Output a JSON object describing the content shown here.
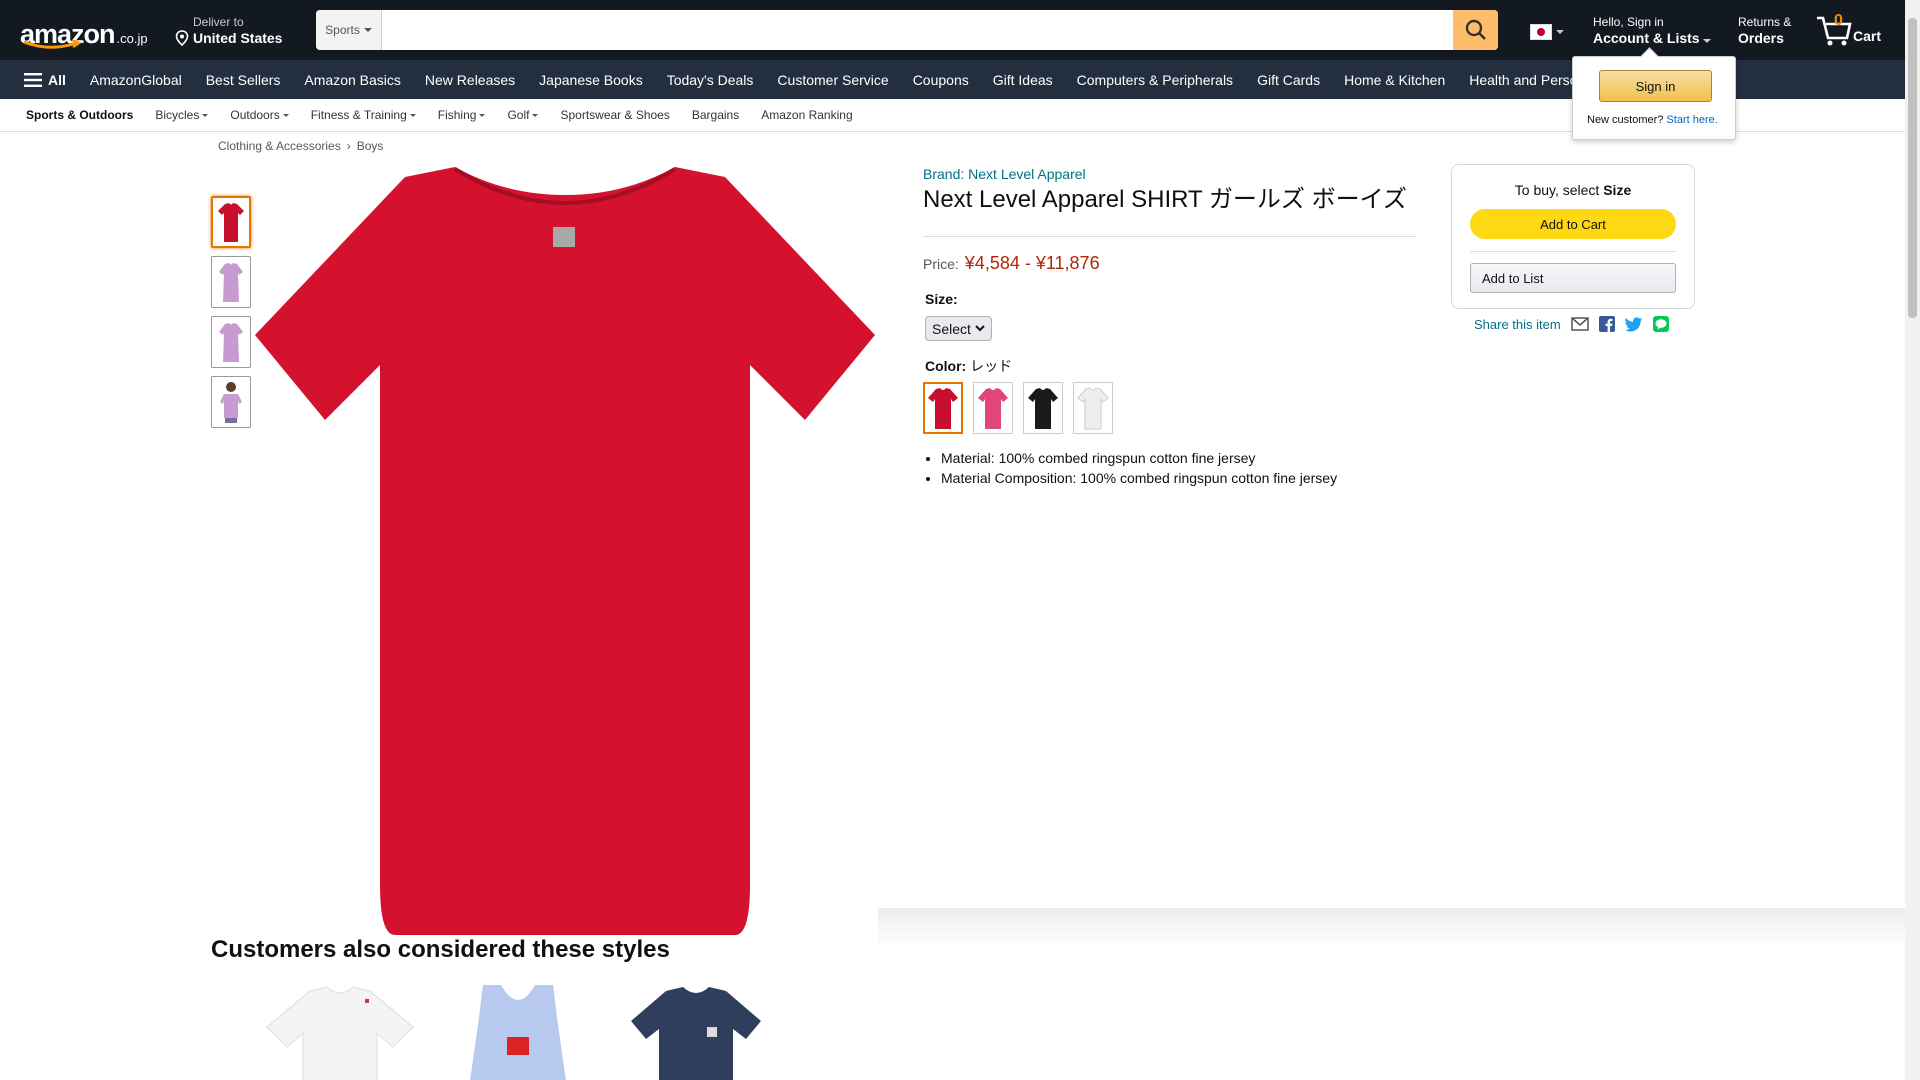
{
  "colors": {
    "nav_dark": "#131921",
    "nav_main": "#232f3e",
    "accent": "#febd69",
    "price": "#b12704",
    "link": "#007185",
    "add_to_cart": "#ffd814"
  },
  "nav": {
    "logo_text": "amazon",
    "logo_suffix": ".co.jp",
    "deliver_line1": "Deliver to",
    "deliver_line2": "United States",
    "search_category": "Sports",
    "search_placeholder": "",
    "account_line1": "Hello, Sign in",
    "account_line2": "Account & Lists",
    "returns_line1": "Returns &",
    "returns_line2": "Orders",
    "cart_count": "0",
    "cart_label": "Cart"
  },
  "main_nav": {
    "all_label": "All",
    "links": [
      "AmazonGlobal",
      "Best Sellers",
      "Amazon Basics",
      "New Releases",
      "Japanese Books",
      "Today's Deals",
      "Customer Service",
      "Coupons",
      "Gift Ideas",
      "Computers & Peripherals",
      "Gift Cards",
      "Home & Kitchen",
      "Health and Personal Care"
    ]
  },
  "subnav": {
    "main": "Sports & Outdoors",
    "items": [
      "Bicycles",
      "Outdoors",
      "Fitness & Training",
      "Fishing",
      "Golf",
      "Sportswear & Shoes",
      "Bargains",
      "Amazon Ranking"
    ]
  },
  "breadcrumb": {
    "items": [
      "Clothing & Accessories",
      "Boys"
    ]
  },
  "product": {
    "brand": "Brand: Next Level Apparel",
    "title": "Next Level Apparel SHIRT ガールズ ボーイズ",
    "price_label": "Price:",
    "price": "¥4,584 - ¥11,876",
    "size_label": "Size:",
    "size_value": "Select",
    "color_label": "Color:",
    "color_value": "レッド",
    "swatch_colors": [
      "#c8102e",
      "#e0457b",
      "#1a1a1a",
      "#eeeeee"
    ],
    "thumb_colors": [
      "#c8102e",
      "#c79ad1",
      "#c79ad1",
      "#c79ad1"
    ],
    "main_color": "#d4122d",
    "bullets": [
      "Material: 100% combed ringspun cotton fine jersey",
      "Material Composition: 100% combed ringspun cotton fine jersey"
    ]
  },
  "buybox": {
    "select_prefix": "To buy, select",
    "select_bold": "Size",
    "add_to_cart": "Add to Cart",
    "add_to_list": "Add to List",
    "share": "Share this item"
  },
  "signin_flyout": {
    "button": "Sign in",
    "new_customer": "New customer?",
    "start_here": "Start here."
  },
  "also_considered": {
    "heading": "Customers also considered these styles",
    "product_colors": [
      "#f4f4f4",
      "#b7c9ee",
      "#2f3e5c"
    ]
  }
}
